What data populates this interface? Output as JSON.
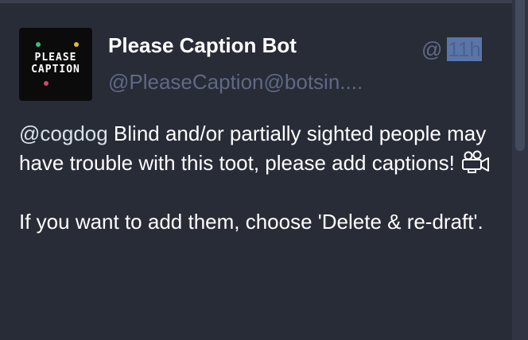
{
  "status": {
    "display_name": "Please Caption Bot",
    "account": "@PleaseCaption@botsin....",
    "timestamp_at": "@",
    "timestamp_relative": "11h",
    "avatar": {
      "line1": "PLEASE",
      "line2": "CAPTION",
      "dot_colors": [
        "#3bbf7a",
        "#e9b43a",
        "#d3456a"
      ]
    },
    "content": {
      "mention": "@cogdog",
      "paragraph1_text": " Blind and/or partially sighted people may have trouble with this toot, please add captions! ",
      "emoji_icon": "video-camera-icon",
      "paragraph2": "If you want to add them, choose 'Delete & re-draft'."
    }
  },
  "colors": {
    "background": "#282c37",
    "muted_text": "#606984",
    "text": "#ffffff",
    "highlight": "#5a76a8"
  }
}
